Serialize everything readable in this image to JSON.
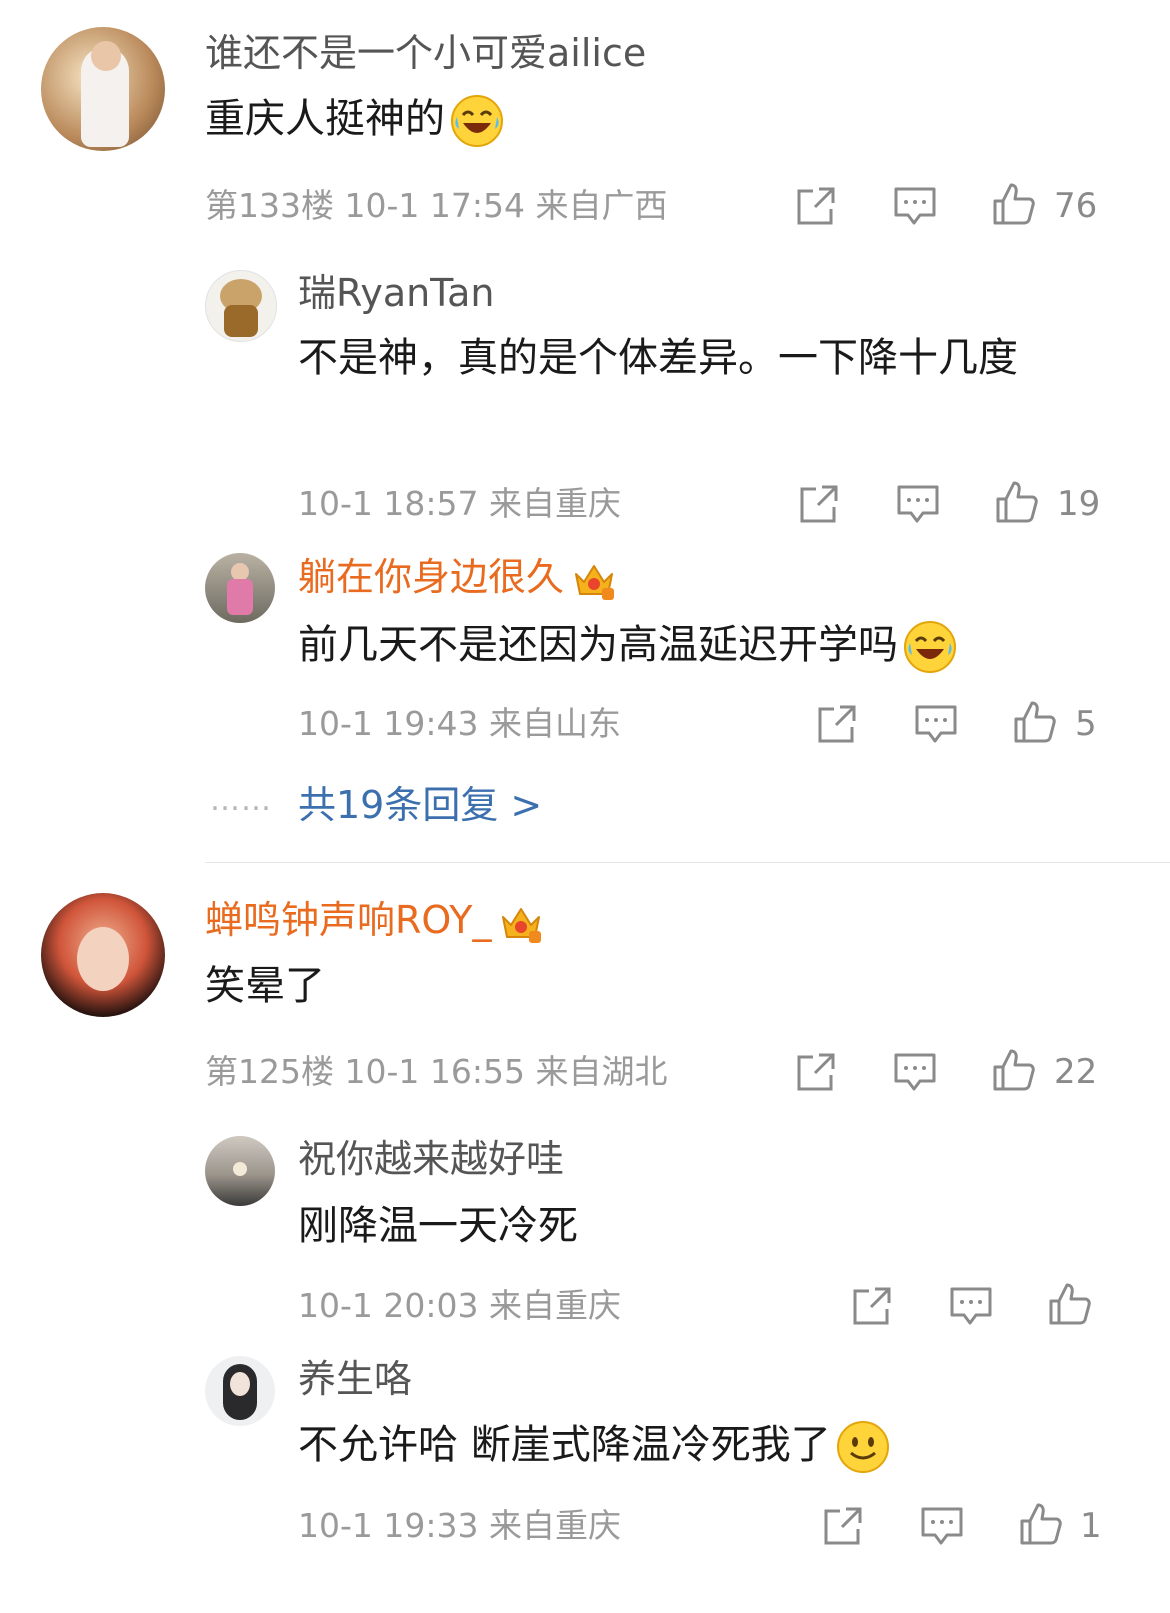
{
  "comments": [
    {
      "username": "谁还不是一个小可爱ailice",
      "content": "重庆人挺神的",
      "meta": "第133楼 10-1 17:54 来自广西",
      "likes": "76",
      "replies": [
        {
          "username": "瑞RyanTan",
          "content": "不是神，真的是个体差异。一下降十几度",
          "meta": "10-1 18:57 来自重庆",
          "likes": "19"
        },
        {
          "username": "躺在你身边很久",
          "content": "前几天不是还因为高温延迟开学吗",
          "meta": "10-1 19:43 来自山东",
          "likes": "5"
        }
      ],
      "more_replies": "共19条回复 >",
      "more_dots": "……"
    },
    {
      "username": "蝉鸣钟声响ROY_",
      "content": "笑晕了",
      "meta": "第125楼 10-1 16:55 来自湖北",
      "likes": "22",
      "replies": [
        {
          "username": "祝你越来越好哇",
          "content": "刚降温一天冷死",
          "meta": "10-1 20:03 来自重庆",
          "likes": ""
        },
        {
          "username": "养生咯",
          "content": "不允许哈 断崖式降温冷死我了",
          "meta": "10-1 19:33 来自重庆",
          "likes": "1"
        }
      ]
    }
  ],
  "colors": {
    "vip_name": "#e86b1f",
    "link": "#3c6fae",
    "meta": "#9a9a9a"
  }
}
